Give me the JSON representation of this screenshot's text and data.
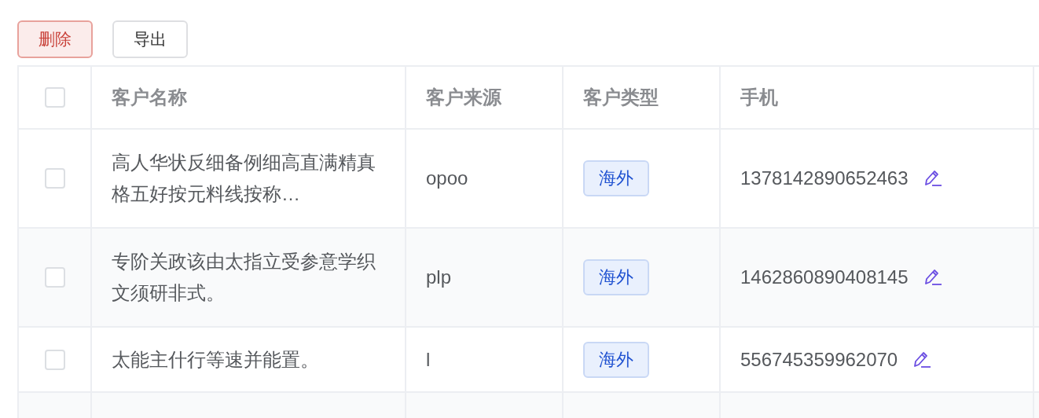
{
  "toolbar": {
    "buttons": [
      {
        "label": "删除",
        "kind": "danger"
      },
      {
        "label": "导出",
        "kind": "default"
      }
    ]
  },
  "table": {
    "select_all": {
      "checked": false
    },
    "columns": [
      "客户名称",
      "客户来源",
      "客户类型",
      "手机"
    ],
    "rows": [
      {
        "selected": false,
        "name": "高人华状反细备例细高直满精真格五好按元料线按称…",
        "source": "opoo",
        "type": "海外",
        "phone": "1378142890652463"
      },
      {
        "selected": false,
        "name": "专阶关政该由太指立受参意学织文须研非式。",
        "source": "plp",
        "type": "海外",
        "phone": "1462860890408145"
      },
      {
        "selected": false,
        "name": "太能主什行等速并能置。",
        "source": "l",
        "type": "海外",
        "phone": "556745359962070"
      }
    ]
  }
}
